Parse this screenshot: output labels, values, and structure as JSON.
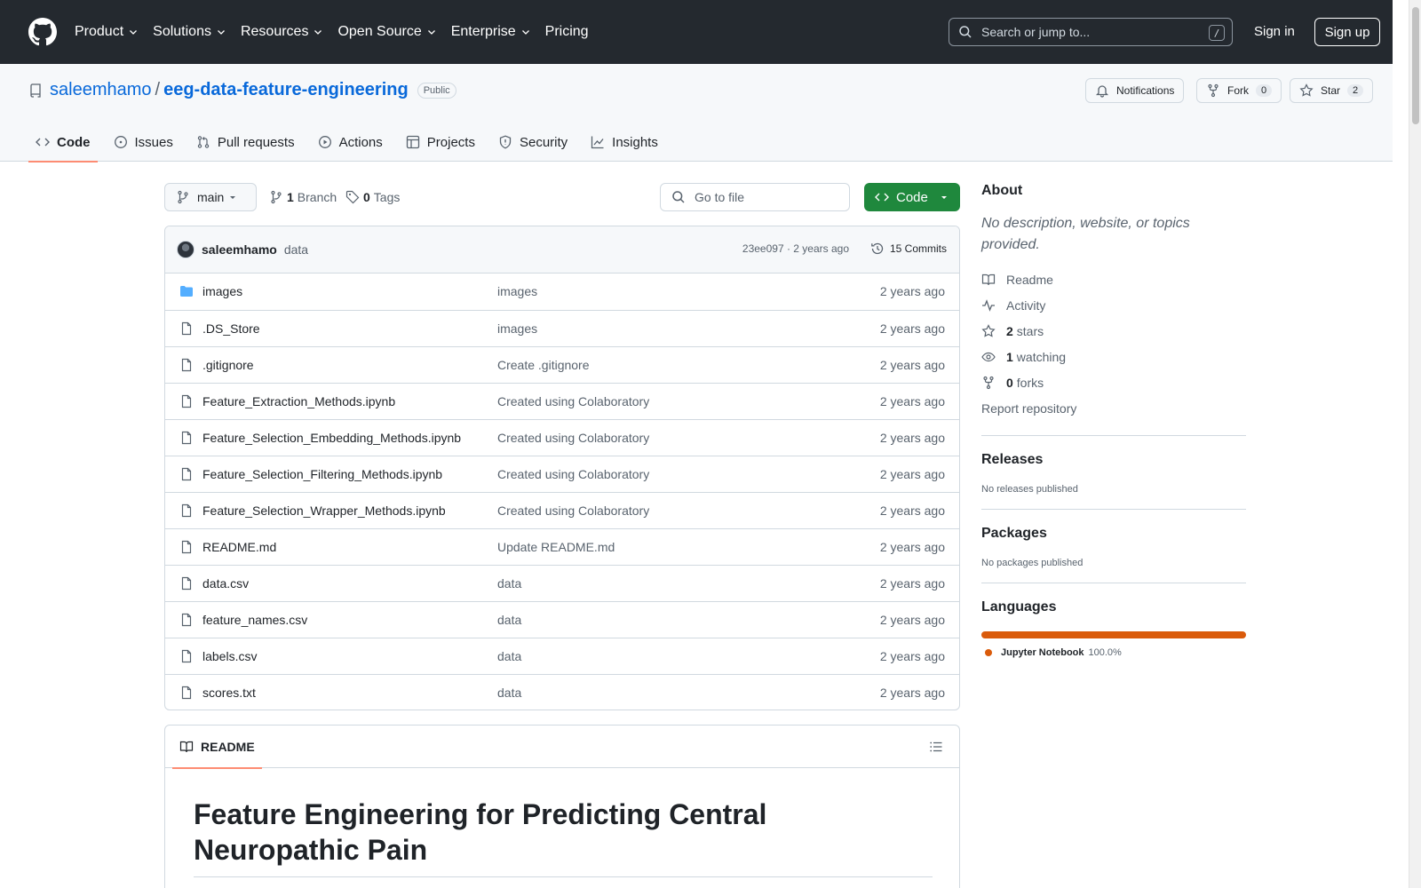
{
  "topnav": {
    "items": [
      {
        "label": "Product",
        "dropdown": true
      },
      {
        "label": "Solutions",
        "dropdown": true
      },
      {
        "label": "Resources",
        "dropdown": true
      },
      {
        "label": "Open Source",
        "dropdown": true
      },
      {
        "label": "Enterprise",
        "dropdown": true
      },
      {
        "label": "Pricing",
        "dropdown": false
      }
    ],
    "search_placeholder": "Search or jump to...",
    "search_shortcut": "/",
    "signin": "Sign in",
    "signup": "Sign up"
  },
  "repo": {
    "owner": "saleemhamo",
    "separator": "/",
    "name": "eeg-data-feature-engineering",
    "visibility": "Public",
    "notifications_label": "Notifications",
    "fork_label": "Fork",
    "fork_count": "0",
    "star_label": "Star",
    "star_count": "2"
  },
  "tabs": [
    {
      "label": "Code",
      "icon": "code-icon",
      "active": true
    },
    {
      "label": "Issues",
      "icon": "issue-opened-icon",
      "active": false
    },
    {
      "label": "Pull requests",
      "icon": "git-pull-request-icon",
      "active": false
    },
    {
      "label": "Actions",
      "icon": "play-icon",
      "active": false
    },
    {
      "label": "Projects",
      "icon": "table-icon",
      "active": false
    },
    {
      "label": "Security",
      "icon": "shield-icon",
      "active": false
    },
    {
      "label": "Insights",
      "icon": "graph-icon",
      "active": false
    }
  ],
  "branchbar": {
    "branch": "main",
    "branch_count": "1",
    "branch_label": "Branch",
    "tag_count": "0",
    "tag_label": "Tags",
    "gofile_placeholder": "Go to file",
    "code_button": "Code"
  },
  "commit": {
    "author": "saleemhamo",
    "message": "data",
    "meta": "23ee097 · 2 years ago",
    "commits_label": "15 Commits"
  },
  "files": [
    {
      "name": "images",
      "type": "folder",
      "message": "images",
      "date": "2 years ago"
    },
    {
      "name": ".DS_Store",
      "type": "file",
      "message": "images",
      "date": "2 years ago"
    },
    {
      "name": ".gitignore",
      "type": "file",
      "message": "Create .gitignore",
      "date": "2 years ago"
    },
    {
      "name": "Feature_Extraction_Methods.ipynb",
      "type": "file",
      "message": "Created using Colaboratory",
      "date": "2 years ago"
    },
    {
      "name": "Feature_Selection_Embedding_Methods.ipynb",
      "type": "file",
      "message": "Created using Colaboratory",
      "date": "2 years ago"
    },
    {
      "name": "Feature_Selection_Filtering_Methods.ipynb",
      "type": "file",
      "message": "Created using Colaboratory",
      "date": "2 years ago"
    },
    {
      "name": "Feature_Selection_Wrapper_Methods.ipynb",
      "type": "file",
      "message": "Created using Colaboratory",
      "date": "2 years ago"
    },
    {
      "name": "README.md",
      "type": "file",
      "message": "Update README.md",
      "date": "2 years ago"
    },
    {
      "name": "data.csv",
      "type": "file",
      "message": "data",
      "date": "2 years ago"
    },
    {
      "name": "feature_names.csv",
      "type": "file",
      "message": "data",
      "date": "2 years ago"
    },
    {
      "name": "labels.csv",
      "type": "file",
      "message": "data",
      "date": "2 years ago"
    },
    {
      "name": "scores.txt",
      "type": "file",
      "message": "data",
      "date": "2 years ago"
    }
  ],
  "readme": {
    "tab_label": "README",
    "heading": "Feature Engineering for Predicting Central Neuropathic Pain"
  },
  "sidebar": {
    "about_title": "About",
    "about_desc": "No description, website, or topics provided.",
    "readme_label": "Readme",
    "activity_label": "Activity",
    "stars_count": "2",
    "stars_label": "stars",
    "watching_count": "1",
    "watching_label": "watching",
    "forks_count": "0",
    "forks_label": "forks",
    "report_label": "Report repository",
    "releases_title": "Releases",
    "releases_empty": "No releases published",
    "packages_title": "Packages",
    "packages_empty": "No packages published",
    "languages_title": "Languages",
    "languages": [
      {
        "name": "Jupyter Notebook",
        "percent": "100.0%",
        "fraction": 1.0,
        "color": "#da5b0b"
      }
    ]
  },
  "colors": {
    "header_bg": "#24292f",
    "link": "#0969da",
    "accent_underline": "#fd8c73",
    "code_button": "#1f883d",
    "language_jupyter": "#da5b0b"
  }
}
